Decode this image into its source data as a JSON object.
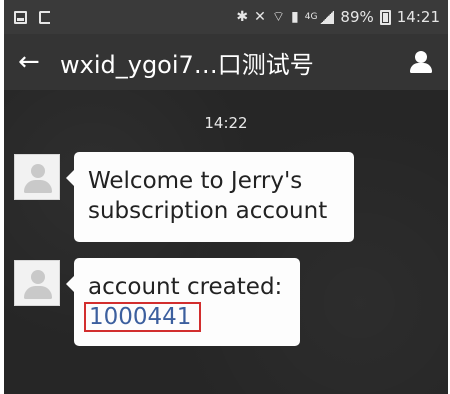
{
  "status_bar": {
    "lte": "4G",
    "battery_percent": "89%",
    "time": "14:21"
  },
  "title_bar": {
    "title": "wxid_ygoi7…口测试号"
  },
  "chat": {
    "time_label": "14:22",
    "messages": [
      {
        "text": "Welcome to Jerry's subscription account"
      },
      {
        "text": "account created:",
        "link": "1000441"
      }
    ]
  },
  "icons": {
    "back": "arrow-left-icon",
    "profile": "person-icon",
    "avatar": "default-avatar-icon"
  },
  "colors": {
    "status_bar_bg": "#3a3a3a",
    "title_bar_bg": "#343434",
    "chat_bg": "#262626",
    "bubble_bg": "#fdfdfd",
    "link": "#3c5f9e",
    "highlight_border": "#d22e2e"
  }
}
